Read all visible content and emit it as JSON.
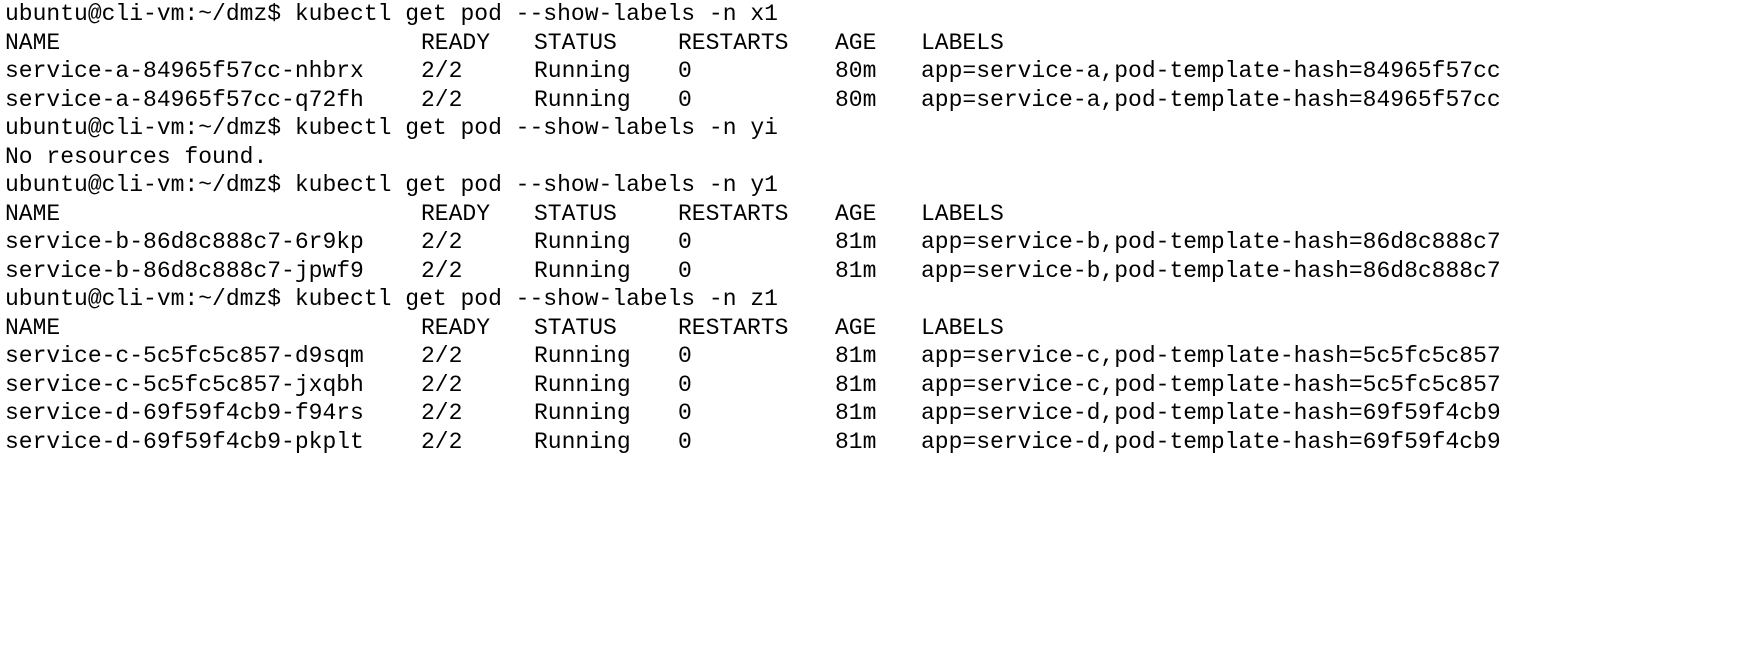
{
  "terminal": {
    "headers": {
      "name": "NAME",
      "ready": "READY",
      "status": "STATUS",
      "restarts": "RESTARTS",
      "age": "AGE",
      "labels": "LABELS"
    },
    "blocks": [
      {
        "command": "ubuntu@cli-vm:~/dmz$ kubectl get pod --show-labels -n x1",
        "rows": [
          {
            "name": "service-a-84965f57cc-nhbrx",
            "ready": "2/2",
            "status": "Running",
            "restarts": "0",
            "age": "80m",
            "labels": "app=service-a,pod-template-hash=84965f57cc"
          },
          {
            "name": "service-a-84965f57cc-q72fh",
            "ready": "2/2",
            "status": "Running",
            "restarts": "0",
            "age": "80m",
            "labels": "app=service-a,pod-template-hash=84965f57cc"
          }
        ]
      },
      {
        "command": "ubuntu@cli-vm:~/dmz$ kubectl get pod --show-labels -n yi",
        "message": "No resources found."
      },
      {
        "command": "ubuntu@cli-vm:~/dmz$ kubectl get pod --show-labels -n y1",
        "rows": [
          {
            "name": "service-b-86d8c888c7-6r9kp",
            "ready": "2/2",
            "status": "Running",
            "restarts": "0",
            "age": "81m",
            "labels": "app=service-b,pod-template-hash=86d8c888c7"
          },
          {
            "name": "service-b-86d8c888c7-jpwf9",
            "ready": "2/2",
            "status": "Running",
            "restarts": "0",
            "age": "81m",
            "labels": "app=service-b,pod-template-hash=86d8c888c7"
          }
        ]
      },
      {
        "command": "ubuntu@cli-vm:~/dmz$ kubectl get pod --show-labels -n z1",
        "rows": [
          {
            "name": "service-c-5c5fc5c857-d9sqm",
            "ready": "2/2",
            "status": "Running",
            "restarts": "0",
            "age": "81m",
            "labels": "app=service-c,pod-template-hash=5c5fc5c857"
          },
          {
            "name": "service-c-5c5fc5c857-jxqbh",
            "ready": "2/2",
            "status": "Running",
            "restarts": "0",
            "age": "81m",
            "labels": "app=service-c,pod-template-hash=5c5fc5c857"
          },
          {
            "name": "service-d-69f59f4cb9-f94rs",
            "ready": "2/2",
            "status": "Running",
            "restarts": "0",
            "age": "81m",
            "labels": "app=service-d,pod-template-hash=69f59f4cb9"
          },
          {
            "name": "service-d-69f59f4cb9-pkplt",
            "ready": "2/2",
            "status": "Running",
            "restarts": "0",
            "age": "81m",
            "labels": "app=service-d,pod-template-hash=69f59f4cb9"
          }
        ]
      }
    ]
  }
}
